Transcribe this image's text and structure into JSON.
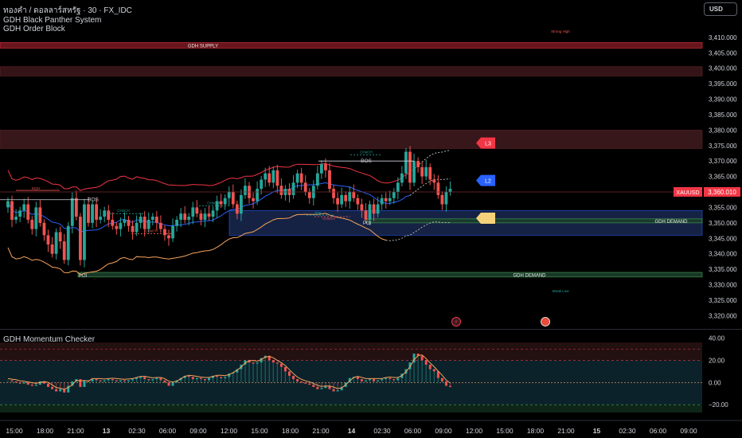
{
  "header": {
    "symbol_line": "ทองคำ / ดอลลาร์สหรัฐ · 30 · FX_IDC",
    "indicator_1": "GDH Black Panther System",
    "indicator_2": "GDH Order Block"
  },
  "currency_button": "USD",
  "oscillator": {
    "title": "GDH Momentum Checker"
  },
  "colors": {
    "background": "#000000",
    "bull": "#26a69a",
    "bear": "#ef5350",
    "supply_zone": "#f23645",
    "demand_zone": "#2962ff",
    "band": "#f23645",
    "orange": "#f7a35c",
    "mid_line": "#2962ff"
  },
  "chart_data": [
    {
      "type": "candlestick",
      "symbol": "XAUUSD",
      "last_price_label": "XAUUSD",
      "last_price": 3360.01,
      "last_price_text": "3,360.010",
      "ylim": [
        3317,
        3420
      ],
      "y_ticks": [
        3320,
        3325,
        3330,
        3335,
        3340,
        3345,
        3350,
        3355,
        3360,
        3365,
        3370,
        3375,
        3380,
        3385,
        3390,
        3395,
        3400,
        3405,
        3410
      ],
      "y_tick_labels": [
        "3,320.000",
        "3,325.000",
        "3,330.000",
        "3,335.000",
        "3,340.000",
        "3,345.000",
        "3,350.000",
        "3,355.000",
        "3,360.000",
        "3,365.000",
        "3,370.000",
        "3,375.000",
        "3,380.000",
        "3,385.000",
        "3,390.000",
        "3,395.000",
        "3,400.000",
        "3,405.000",
        "3,410.000"
      ],
      "x_ticks": [
        "15:00",
        "18:00",
        "21:00",
        "13",
        "02:30",
        "06:00",
        "09:00",
        "12:00",
        "15:00",
        "18:00",
        "21:00",
        "14",
        "02:30",
        "06:00",
        "09:00",
        "12:00",
        "15:00",
        "18:00",
        "21:00",
        "15",
        "02:30",
        "06:00",
        "09:00"
      ],
      "x_tick_bold": [
        false,
        false,
        false,
        true,
        false,
        false,
        false,
        false,
        false,
        false,
        false,
        true,
        false,
        false,
        false,
        false,
        false,
        false,
        false,
        true,
        false,
        false,
        false
      ],
      "close": [
        3357,
        3351,
        3352,
        3354,
        3356,
        3351,
        3348,
        3355,
        3350,
        3346,
        3343,
        3340,
        3347,
        3344,
        3338,
        3349,
        3358,
        3352,
        3338,
        3356,
        3350,
        3356,
        3351,
        3352,
        3354,
        3351,
        3349,
        3348,
        3350,
        3351,
        3349,
        3347,
        3350,
        3352,
        3348,
        3351,
        3352,
        3350,
        3348,
        3346,
        3345,
        3349,
        3351,
        3353,
        3351,
        3352,
        3355,
        3353,
        3351,
        3353,
        3352,
        3354,
        3357,
        3356,
        3358,
        3360,
        3356,
        3353,
        3359,
        3362,
        3358,
        3357,
        3361,
        3364,
        3366,
        3363,
        3367,
        3362,
        3359,
        3361,
        3359,
        3363,
        3366,
        3363,
        3360,
        3358,
        3362,
        3366,
        3369,
        3367,
        3361,
        3358,
        3356,
        3359,
        3357,
        3360,
        3358,
        3356,
        3354,
        3351,
        3356,
        3353,
        3356,
        3358,
        3357,
        3358,
        3360,
        3363,
        3366,
        3373,
        3363,
        3370,
        3368,
        3365,
        3368,
        3364,
        3363,
        3359,
        3356,
        3360,
        3361
      ],
      "zones": [
        {
          "label": "GDH SUPPLY",
          "from": 3406.5,
          "to": 3408.3
        },
        {
          "label": "",
          "from": 3397.5,
          "to": 3400.5
        },
        {
          "label": "",
          "from": 3374,
          "to": 3380
        },
        {
          "label": "",
          "from": 3346,
          "to": 3354
        },
        {
          "label": "GDH DEMAND",
          "from": 3350,
          "to": 3351.3
        },
        {
          "label": "GDH DEMAND",
          "from": 3332.5,
          "to": 3334
        }
      ],
      "level_labels": [
        "Strong High",
        "Weak Low"
      ],
      "structure_labels": [
        "BOS",
        "BOS",
        "CHoCH",
        "CHoCH",
        "CHoCH",
        "CHoCH",
        "CHoCH",
        "EQH",
        "EQL",
        "POI",
        "POI"
      ],
      "tags": [
        "L3",
        "L2"
      ]
    },
    {
      "type": "histogram",
      "name": "GDH Momentum Checker",
      "ylim": [
        -27,
        36
      ],
      "y_ticks": [
        40,
        20,
        0,
        -20
      ],
      "y_tick_labels": [
        "40.00",
        "20.00",
        "0.00",
        "−20.00"
      ],
      "values": [
        2,
        1,
        0,
        -1,
        0,
        -2,
        -3,
        -2,
        1,
        -1,
        -4,
        -6,
        -8,
        -6,
        -9,
        -3,
        1,
        3,
        -4,
        2,
        1,
        3,
        2,
        1,
        2,
        3,
        2,
        1,
        2,
        1,
        2,
        3,
        4,
        5,
        3,
        2,
        3,
        4,
        2,
        0,
        -3,
        0,
        2,
        4,
        6,
        5,
        3,
        4,
        3,
        2,
        4,
        6,
        5,
        4,
        5,
        8,
        9,
        12,
        16,
        20,
        18,
        17,
        18,
        22,
        24,
        20,
        18,
        17,
        14,
        10,
        6,
        3,
        1,
        0,
        -1,
        -2,
        -4,
        -6,
        -5,
        -3,
        -6,
        -8,
        -7,
        -4,
        0,
        4,
        5,
        3,
        1,
        2,
        3,
        1,
        2,
        3,
        4,
        3,
        2,
        4,
        8,
        12,
        18,
        26,
        24,
        20,
        16,
        12,
        10,
        4,
        1,
        -3,
        -4
      ]
    }
  ]
}
